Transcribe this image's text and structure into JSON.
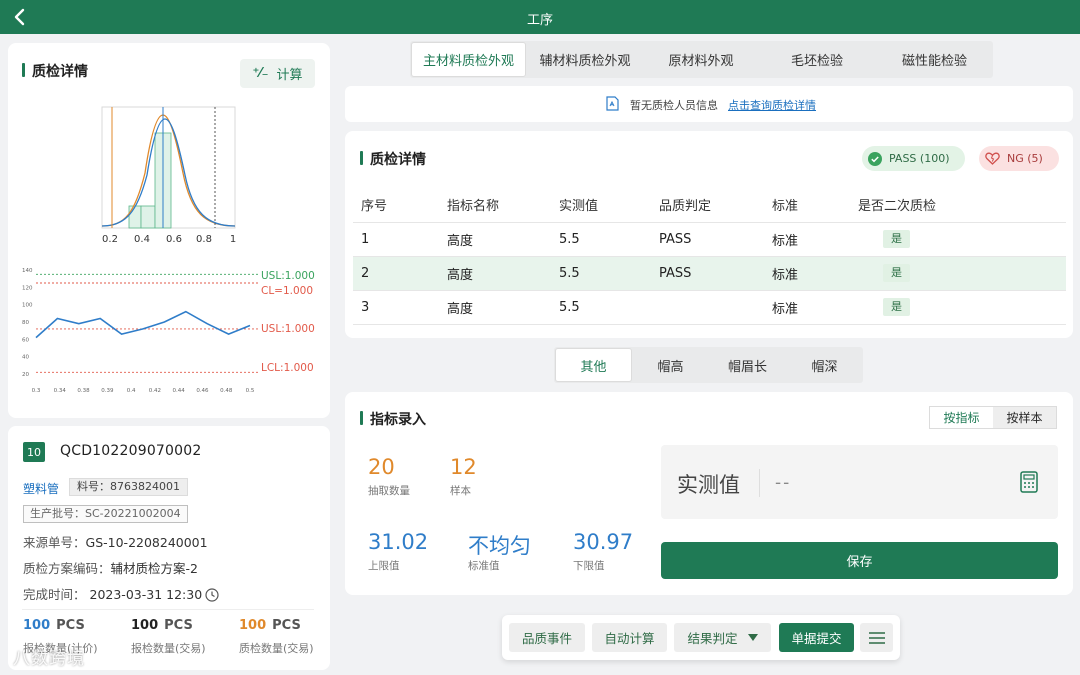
{
  "header": {
    "title": "工序"
  },
  "left_panel": {
    "title": "质检详情",
    "calc_label": "计算",
    "histogram": {
      "tick_labels": [
        "0.2",
        "0.4",
        "0.6",
        "0.8",
        "1"
      ]
    },
    "control_chart": {
      "y_ticks": [
        "140",
        "120",
        "100",
        "80",
        "60",
        "40",
        "20"
      ],
      "x_ticks": [
        "0.3",
        "0.34",
        "0.38",
        "0.39",
        "0.4",
        "0.42",
        "0.44",
        "0.46",
        "0.48",
        "0.5"
      ],
      "limit_labels": {
        "usl_top": "USL:1.000",
        "cl": "CL=1.000",
        "usl_mid": "USL:1.000",
        "lcl": "LCL:1.000"
      },
      "limits": {
        "usl_top": 135,
        "cl": 125,
        "usl_mid": 72,
        "lcl": 22
      },
      "series": [
        62,
        84,
        78,
        84,
        66,
        72,
        80,
        92,
        78,
        66,
        76
      ],
      "colors": {
        "series": "#2f7dc9",
        "usl": "#3aa35e",
        "cl": "#e25a4a",
        "lcl": "#e25a4a"
      }
    }
  },
  "order": {
    "badge": "10",
    "number": "QCD102209070002",
    "material_name": "塑料管",
    "material_code": "料号：8763824001",
    "batch": "生产批号：SC-20221002004",
    "source_label": "来源单号：",
    "source_value": "GS-10-2208240001",
    "plan_label": "质检方案编码：",
    "plan_value": "辅材质检方案-2",
    "time_label": "完成时间：",
    "time_value": "2023-03-31 12:30",
    "stats": [
      {
        "value": "100",
        "unit": "PCS",
        "label": "报检数量(计价)",
        "color": "#2f7dc9"
      },
      {
        "value": "100",
        "unit": "PCS",
        "label": "报检数量(交易)",
        "color": "#222222"
      },
      {
        "value": "100",
        "unit": "PCS",
        "label": "质检数量(交易)",
        "color": "#e0892b"
      }
    ]
  },
  "tabs": [
    "主材料质检外观",
    "辅材料质检外观",
    "原材料外观",
    "毛坯检验",
    "磁性能检验"
  ],
  "active_tab": 0,
  "notice": {
    "text": "暂无质检人员信息",
    "link": "点击查询质检详情"
  },
  "detail": {
    "title": "质检详情",
    "pass_label": "PASS (100)",
    "ng_label": "NG (5)",
    "columns": [
      "序号",
      "指标名称",
      "实测值",
      "品质判定",
      "标准",
      "是否二次质检"
    ],
    "rows": [
      {
        "no": "1",
        "name": "高度",
        "value": "5.5",
        "verdict": "PASS",
        "std": "标准",
        "recheck": "是"
      },
      {
        "no": "2",
        "name": "高度",
        "value": "5.5",
        "verdict": "PASS",
        "std": "标准",
        "recheck": "是"
      },
      {
        "no": "3",
        "name": "高度",
        "value": "5.5",
        "verdict": "",
        "std": "标准",
        "recheck": "是"
      }
    ]
  },
  "subtabs": [
    "其他",
    "帽高",
    "帽眉长",
    "帽深"
  ],
  "entry": {
    "title": "指标录入",
    "mode_by_index": "按指标",
    "mode_by_sample": "按样本",
    "sample_count": "20",
    "sample_count_label": "抽取数量",
    "sample": "12",
    "sample_label": "样本",
    "upper": "31.02",
    "upper_label": "上限值",
    "standard": "不均匀",
    "standard_label": "标准值",
    "lower": "30.97",
    "lower_label": "下限值",
    "measure_label": "实测值",
    "measure_value": "--",
    "save_label": "保存",
    "colors": {
      "orange": "#e0892b",
      "blue": "#2f7dc9"
    }
  },
  "bottom_bar": {
    "quality_event": "品质事件",
    "auto_calc": "自动计算",
    "result_judge": "结果判定",
    "submit": "单据提交"
  },
  "watermark": "八数跨境"
}
